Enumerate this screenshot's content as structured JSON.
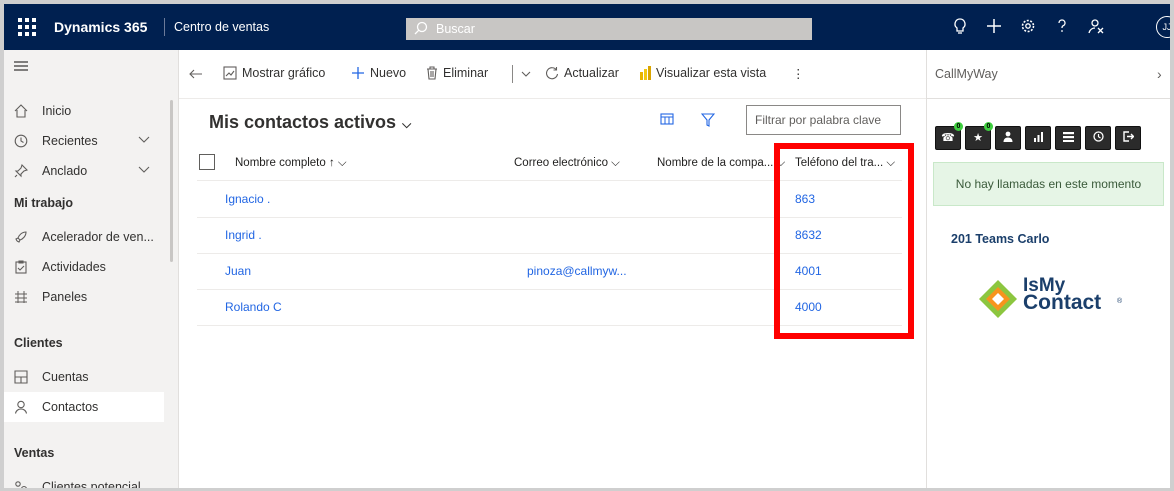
{
  "topbar": {
    "app_title": "Dynamics 365",
    "app_name": "Centro de ventas",
    "search_placeholder": "Buscar",
    "avatar_initials": "JJ"
  },
  "sidebar": {
    "nav": [
      {
        "label": "Inicio",
        "icon": "home-icon"
      },
      {
        "label": "Recientes",
        "icon": "clock-icon"
      },
      {
        "label": "Anclado",
        "icon": "pin-icon"
      }
    ],
    "sections": [
      {
        "heading": "Mi trabajo",
        "items": [
          {
            "label": "Acelerador de ven...",
            "icon": "rocket-icon"
          },
          {
            "label": "Actividades",
            "icon": "clipboard-icon"
          },
          {
            "label": "Paneles",
            "icon": "dashboard-icon"
          }
        ]
      },
      {
        "heading": "Clientes",
        "items": [
          {
            "label": "Cuentas",
            "icon": "building-icon"
          },
          {
            "label": "Contactos",
            "icon": "person-icon"
          }
        ]
      },
      {
        "heading": "Ventas",
        "items": [
          {
            "label": "Clientes potencial",
            "icon": "leads-icon"
          }
        ]
      }
    ]
  },
  "commandbar": {
    "show_chart": "Mostrar gráfico",
    "new": "Nuevo",
    "delete": "Eliminar",
    "refresh": "Actualizar",
    "visualize": "Visualizar esta vista"
  },
  "view": {
    "title": "Mis contactos activos",
    "filter_placeholder": "Filtrar por palabra clave",
    "columns": [
      "Nombre completo ↑ ⌵",
      "Correo electrónico ⌵",
      "Nombre de la compa... ⌵",
      "Teléfono del tra... ⌵"
    ],
    "rows": [
      {
        "name": "Ignacio .",
        "email": "",
        "company": "",
        "phone": "863"
      },
      {
        "name": "Ingrid .",
        "email": "",
        "company": "",
        "phone": "8632"
      },
      {
        "name": "Juan",
        "email": "pinoza@callmyw...",
        "company": "",
        "phone": "4001"
      },
      {
        "name": "Rolando C",
        "email": "",
        "company": "",
        "phone": "4000"
      }
    ]
  },
  "right_pane": {
    "title": "CallMyWay",
    "tool_badges": [
      "0",
      "0"
    ],
    "status": "No hay llamadas en este momento",
    "team": "201 Teams Carlo",
    "logo_line1": "IsMy",
    "logo_line2": "Contact",
    "logo_reg": "®"
  },
  "colors": {
    "topbar": "#002050",
    "link": "#2266e3",
    "highlight": "#ff0000",
    "logo": "#1b3f6b"
  }
}
